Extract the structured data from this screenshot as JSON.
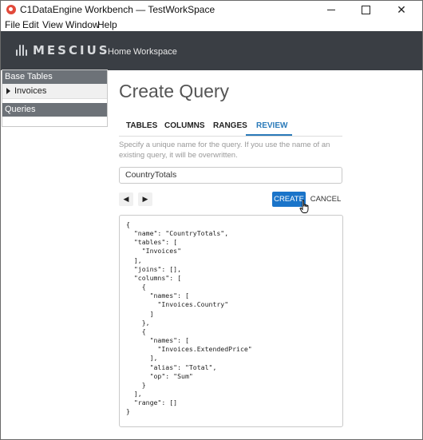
{
  "window": {
    "title": "C1DataEngine Workbench — TestWorkSpace",
    "controls": {
      "minimize": "minimize",
      "maximize": "maximize",
      "close": "✕"
    }
  },
  "menu": {
    "items": [
      "File",
      "Edit",
      "View",
      "Window",
      "Help"
    ]
  },
  "header": {
    "logo": "MESCIUS",
    "nav": [
      "Home",
      "Workspace"
    ]
  },
  "sidebar": {
    "sections": [
      {
        "label": "Base Tables",
        "items": [
          "Invoices"
        ]
      },
      {
        "label": "Queries",
        "items": []
      }
    ]
  },
  "main": {
    "title": "Create Query",
    "tabs": [
      "TABLES",
      "COLUMNS",
      "RANGES",
      "REVIEW"
    ],
    "active_tab": "REVIEW",
    "help_text": "Specify a unique name for the query. If you use the name of an existing query, it will be overwritten.",
    "query_name": "CountryTotals",
    "prev_label": "◀",
    "next_label": "▶",
    "create_label": "CREATE",
    "cancel_label": "CANCEL",
    "json_preview": "{\n  \"name\": \"CountryTotals\",\n  \"tables\": [\n    \"Invoices\"\n  ],\n  \"joins\": [],\n  \"columns\": [\n    {\n      \"names\": [\n        \"Invoices.Country\"\n      ]\n    },\n    {\n      \"names\": [\n        \"Invoices.ExtendedPrice\"\n      ],\n      \"alias\": \"Total\",\n      \"op\": \"Sum\"\n    }\n  ],\n  \"range\": []\n}"
  },
  "colors": {
    "header_bg": "#3a3e44",
    "accent": "#2a7ab9",
    "create_button": "#1a74c9",
    "sidebar_header": "#6d7278"
  }
}
